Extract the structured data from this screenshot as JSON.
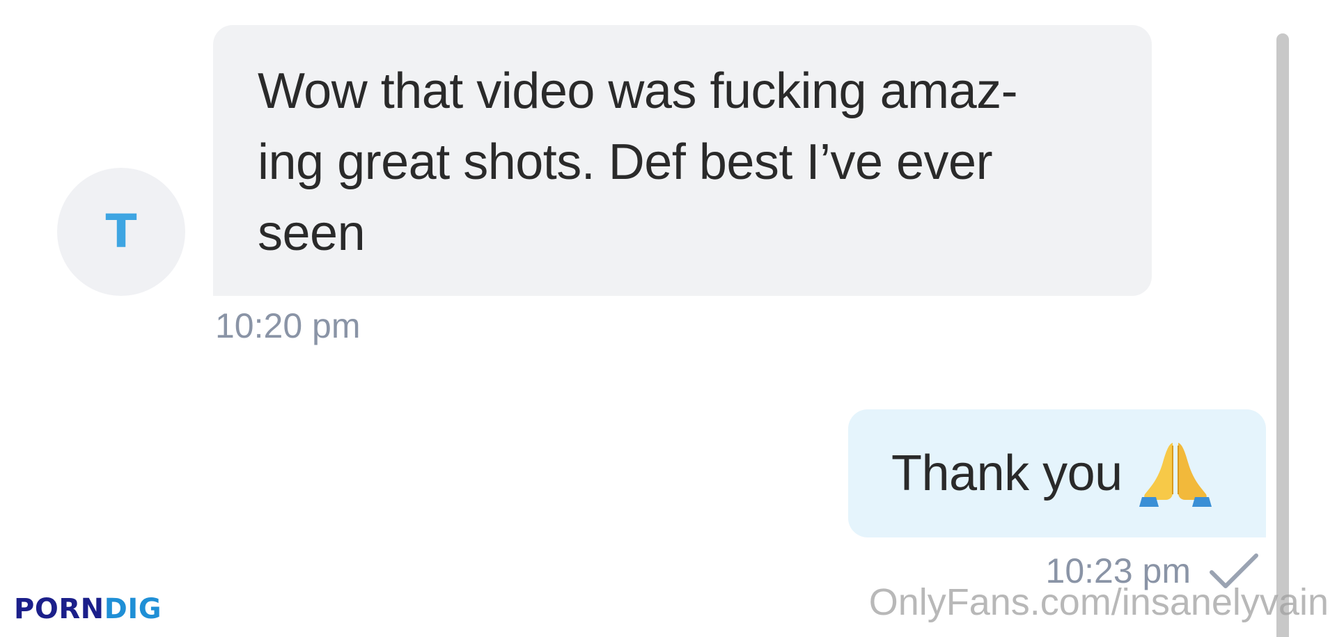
{
  "conversation": {
    "incoming": {
      "avatar_letter": "T",
      "message": "Wow that video was fucking amaz-\ning great shots. Def best I’ve ever\nseen",
      "time": "10:20 pm"
    },
    "outgoing": {
      "message": "Thank you",
      "emoji_icon": "folded-hands-icon",
      "time": "10:23 pm",
      "status_icon": "checkmark-icon"
    }
  },
  "watermarks": {
    "left_part1": "PORN",
    "left_part2": "DIG",
    "right": "OnlyFans.com/insanelyvain"
  },
  "colors": {
    "incoming_bubble": "#f1f2f4",
    "outgoing_bubble": "#e5f4fc",
    "avatar_letter": "#3ea5e2",
    "timestamp": "#8a94a6"
  }
}
